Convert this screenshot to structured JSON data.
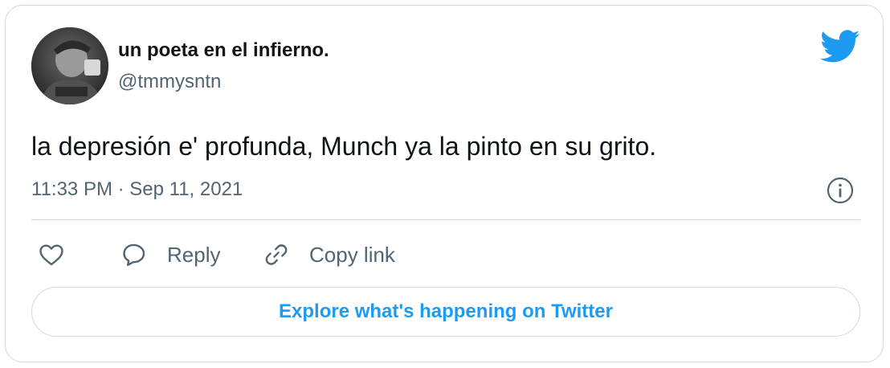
{
  "tweet": {
    "author": {
      "display_name": "un poeta en el infierno.",
      "handle": "@tmmysntn",
      "avatar_icon": "avatar"
    },
    "text": "la depresión e' profunda, Munch ya la pinto en su grito.",
    "timestamp": "11:33 PM · Sep 11, 2021"
  },
  "actions": {
    "like_icon": "heart-icon",
    "reply_label": "Reply",
    "reply_icon": "speech-bubble-icon",
    "copy_label": "Copy link",
    "copy_icon": "link-icon"
  },
  "explore": {
    "label": "Explore what's happening on Twitter"
  },
  "colors": {
    "brand": "#1d9bf0",
    "text_primary": "#0f1419",
    "text_secondary": "#536471",
    "border": "#cfd9de"
  }
}
